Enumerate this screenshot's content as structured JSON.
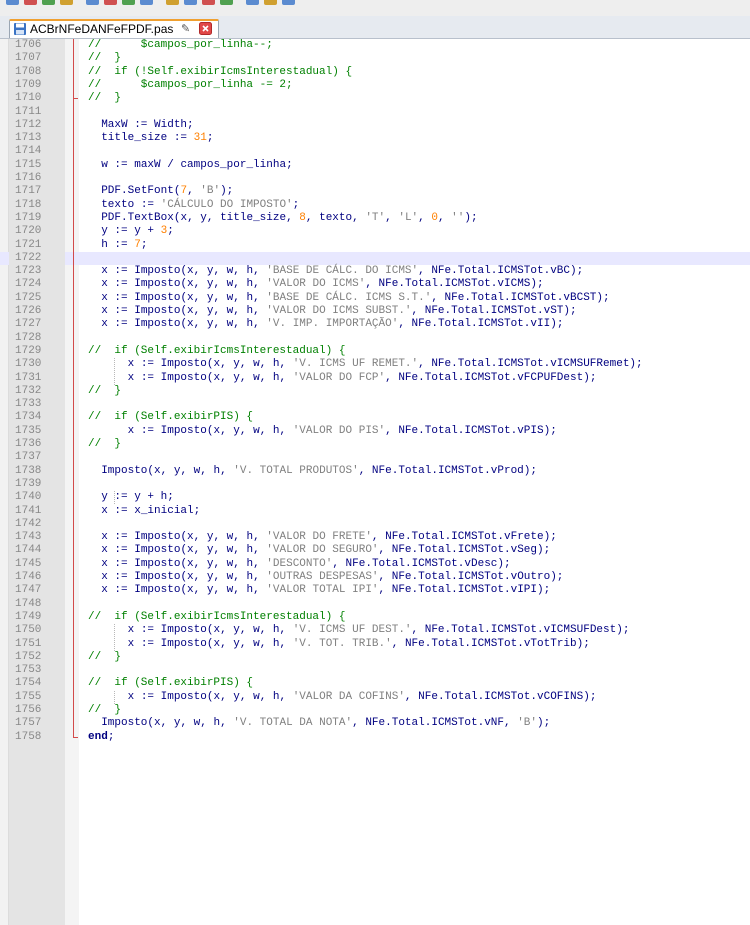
{
  "tab": {
    "filename": "ACBrNFeDANFeFPDF.pas",
    "pin_glyph": "✎"
  },
  "editor": {
    "current_line": 1722,
    "lines": [
      {
        "n": "1706",
        "text": "//      $campos_por_linha--;"
      },
      {
        "n": "1707",
        "text": "//  }"
      },
      {
        "n": "1708",
        "text": "//  if (!Self.exibirIcmsInterestadual) {"
      },
      {
        "n": "1709",
        "text": "//      $campos_por_linha -= 2;"
      },
      {
        "n": "1710",
        "text": "//  }"
      },
      {
        "n": "1711",
        "text": ""
      },
      {
        "n": "1712",
        "text": "  MaxW := Width;"
      },
      {
        "n": "1713",
        "text": "  title_size := 31;"
      },
      {
        "n": "1714",
        "text": ""
      },
      {
        "n": "1715",
        "text": "  w := maxW / campos_por_linha;"
      },
      {
        "n": "1716",
        "text": ""
      },
      {
        "n": "1717",
        "text": "  PDF.SetFont(7, 'B');"
      },
      {
        "n": "1718",
        "text": "  texto := 'CÁLCULO DO IMPOSTO';"
      },
      {
        "n": "1719",
        "text": "  PDF.TextBox(x, y, title_size, 8, texto, 'T', 'L', 0, '');"
      },
      {
        "n": "1720",
        "text": "  y := y + 3;"
      },
      {
        "n": "1721",
        "text": "  h := 7;"
      },
      {
        "n": "1722",
        "text": ""
      },
      {
        "n": "1723",
        "text": "  x := Imposto(x, y, w, h, 'BASE DE CÁLC. DO ICMS', NFe.Total.ICMSTot.vBC);"
      },
      {
        "n": "1724",
        "text": "  x := Imposto(x, y, w, h, 'VALOR DO ICMS', NFe.Total.ICMSTot.vICMS);"
      },
      {
        "n": "1725",
        "text": "  x := Imposto(x, y, w, h, 'BASE DE CÁLC. ICMS S.T.', NFe.Total.ICMSTot.vBCST);"
      },
      {
        "n": "1726",
        "text": "  x := Imposto(x, y, w, h, 'VALOR DO ICMS SUBST.', NFe.Total.ICMSTot.vST);"
      },
      {
        "n": "1727",
        "text": "  x := Imposto(x, y, w, h, 'V. IMP. IMPORTAÇÃO', NFe.Total.ICMSTot.vII);"
      },
      {
        "n": "1728",
        "text": ""
      },
      {
        "n": "1729",
        "text": "//  if (Self.exibirIcmsInterestadual) {"
      },
      {
        "n": "1730",
        "text": "      x := Imposto(x, y, w, h, 'V. ICMS UF REMET.', NFe.Total.ICMSTot.vICMSUFRemet);"
      },
      {
        "n": "1731",
        "text": "      x := Imposto(x, y, w, h, 'VALOR DO FCP', NFe.Total.ICMSTot.vFCPUFDest);"
      },
      {
        "n": "1732",
        "text": "//  }"
      },
      {
        "n": "1733",
        "text": ""
      },
      {
        "n": "1734",
        "text": "//  if (Self.exibirPIS) {"
      },
      {
        "n": "1735",
        "text": "      x := Imposto(x, y, w, h, 'VALOR DO PIS', NFe.Total.ICMSTot.vPIS);"
      },
      {
        "n": "1736",
        "text": "//  }"
      },
      {
        "n": "1737",
        "text": ""
      },
      {
        "n": "1738",
        "text": "  Imposto(x, y, w, h, 'V. TOTAL PRODUTOS', NFe.Total.ICMSTot.vProd);"
      },
      {
        "n": "1739",
        "text": ""
      },
      {
        "n": "1740",
        "text": "  y := y + h;"
      },
      {
        "n": "1741",
        "text": "  x := x_inicial;"
      },
      {
        "n": "1742",
        "text": ""
      },
      {
        "n": "1743",
        "text": "  x := Imposto(x, y, w, h, 'VALOR DO FRETE', NFe.Total.ICMSTot.vFrete);"
      },
      {
        "n": "1744",
        "text": "  x := Imposto(x, y, w, h, 'VALOR DO SEGURO', NFe.Total.ICMSTot.vSeg);"
      },
      {
        "n": "1745",
        "text": "  x := Imposto(x, y, w, h, 'DESCONTO', NFe.Total.ICMSTot.vDesc);"
      },
      {
        "n": "1746",
        "text": "  x := Imposto(x, y, w, h, 'OUTRAS DESPESAS', NFe.Total.ICMSTot.vOutro);"
      },
      {
        "n": "1747",
        "text": "  x := Imposto(x, y, w, h, 'VALOR TOTAL IPI', NFe.Total.ICMSTot.vIPI);"
      },
      {
        "n": "1748",
        "text": ""
      },
      {
        "n": "1749",
        "text": "//  if (Self.exibirIcmsInterestadual) {"
      },
      {
        "n": "1750",
        "text": "      x := Imposto(x, y, w, h, 'V. ICMS UF DEST.', NFe.Total.ICMSTot.vICMSUFDest);"
      },
      {
        "n": "1751",
        "text": "      x := Imposto(x, y, w, h, 'V. TOT. TRIB.', NFe.Total.ICMSTot.vTotTrib);"
      },
      {
        "n": "1752",
        "text": "//  }"
      },
      {
        "n": "1753",
        "text": ""
      },
      {
        "n": "1754",
        "text": "//  if (Self.exibirPIS) {"
      },
      {
        "n": "1755",
        "text": "      x := Imposto(x, y, w, h, 'VALOR DA COFINS', NFe.Total.ICMSTot.vCOFINS);"
      },
      {
        "n": "1756",
        "text": "//  }"
      },
      {
        "n": "1757",
        "text": "  Imposto(x, y, w, h, 'V. TOTAL DA NOTA', NFe.Total.ICMSTot.vNF, 'B');"
      },
      {
        "n": "1758",
        "text": "end;"
      }
    ]
  },
  "colors": {
    "comment": "#008000",
    "string": "#808080",
    "number": "#ff8000",
    "identifier": "#000080",
    "current_line_bg": "#e8e8ff",
    "fold_line": "#d24b4b"
  },
  "icons": {
    "tab_save": "floppy-disk-icon",
    "tab_close": "close-icon"
  }
}
